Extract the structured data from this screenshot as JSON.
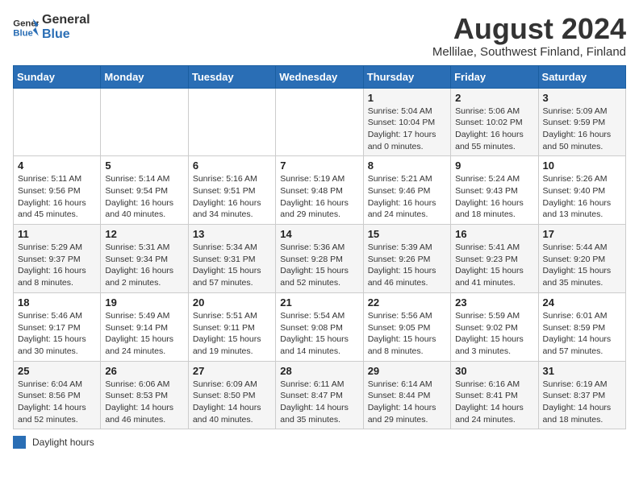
{
  "logo": {
    "general": "General",
    "blue": "Blue"
  },
  "title": "August 2024",
  "subtitle": "Mellilae, Southwest Finland, Finland",
  "days_of_week": [
    "Sunday",
    "Monday",
    "Tuesday",
    "Wednesday",
    "Thursday",
    "Friday",
    "Saturday"
  ],
  "weeks": [
    [
      {
        "day": "",
        "sunrise": "",
        "sunset": "",
        "daylight": ""
      },
      {
        "day": "",
        "sunrise": "",
        "sunset": "",
        "daylight": ""
      },
      {
        "day": "",
        "sunrise": "",
        "sunset": "",
        "daylight": ""
      },
      {
        "day": "",
        "sunrise": "",
        "sunset": "",
        "daylight": ""
      },
      {
        "day": "1",
        "sunrise": "Sunrise: 5:04 AM",
        "sunset": "Sunset: 10:04 PM",
        "daylight": "Daylight: 17 hours and 0 minutes."
      },
      {
        "day": "2",
        "sunrise": "Sunrise: 5:06 AM",
        "sunset": "Sunset: 10:02 PM",
        "daylight": "Daylight: 16 hours and 55 minutes."
      },
      {
        "day": "3",
        "sunrise": "Sunrise: 5:09 AM",
        "sunset": "Sunset: 9:59 PM",
        "daylight": "Daylight: 16 hours and 50 minutes."
      }
    ],
    [
      {
        "day": "4",
        "sunrise": "Sunrise: 5:11 AM",
        "sunset": "Sunset: 9:56 PM",
        "daylight": "Daylight: 16 hours and 45 minutes."
      },
      {
        "day": "5",
        "sunrise": "Sunrise: 5:14 AM",
        "sunset": "Sunset: 9:54 PM",
        "daylight": "Daylight: 16 hours and 40 minutes."
      },
      {
        "day": "6",
        "sunrise": "Sunrise: 5:16 AM",
        "sunset": "Sunset: 9:51 PM",
        "daylight": "Daylight: 16 hours and 34 minutes."
      },
      {
        "day": "7",
        "sunrise": "Sunrise: 5:19 AM",
        "sunset": "Sunset: 9:48 PM",
        "daylight": "Daylight: 16 hours and 29 minutes."
      },
      {
        "day": "8",
        "sunrise": "Sunrise: 5:21 AM",
        "sunset": "Sunset: 9:46 PM",
        "daylight": "Daylight: 16 hours and 24 minutes."
      },
      {
        "day": "9",
        "sunrise": "Sunrise: 5:24 AM",
        "sunset": "Sunset: 9:43 PM",
        "daylight": "Daylight: 16 hours and 18 minutes."
      },
      {
        "day": "10",
        "sunrise": "Sunrise: 5:26 AM",
        "sunset": "Sunset: 9:40 PM",
        "daylight": "Daylight: 16 hours and 13 minutes."
      }
    ],
    [
      {
        "day": "11",
        "sunrise": "Sunrise: 5:29 AM",
        "sunset": "Sunset: 9:37 PM",
        "daylight": "Daylight: 16 hours and 8 minutes."
      },
      {
        "day": "12",
        "sunrise": "Sunrise: 5:31 AM",
        "sunset": "Sunset: 9:34 PM",
        "daylight": "Daylight: 16 hours and 2 minutes."
      },
      {
        "day": "13",
        "sunrise": "Sunrise: 5:34 AM",
        "sunset": "Sunset: 9:31 PM",
        "daylight": "Daylight: 15 hours and 57 minutes."
      },
      {
        "day": "14",
        "sunrise": "Sunrise: 5:36 AM",
        "sunset": "Sunset: 9:28 PM",
        "daylight": "Daylight: 15 hours and 52 minutes."
      },
      {
        "day": "15",
        "sunrise": "Sunrise: 5:39 AM",
        "sunset": "Sunset: 9:26 PM",
        "daylight": "Daylight: 15 hours and 46 minutes."
      },
      {
        "day": "16",
        "sunrise": "Sunrise: 5:41 AM",
        "sunset": "Sunset: 9:23 PM",
        "daylight": "Daylight: 15 hours and 41 minutes."
      },
      {
        "day": "17",
        "sunrise": "Sunrise: 5:44 AM",
        "sunset": "Sunset: 9:20 PM",
        "daylight": "Daylight: 15 hours and 35 minutes."
      }
    ],
    [
      {
        "day": "18",
        "sunrise": "Sunrise: 5:46 AM",
        "sunset": "Sunset: 9:17 PM",
        "daylight": "Daylight: 15 hours and 30 minutes."
      },
      {
        "day": "19",
        "sunrise": "Sunrise: 5:49 AM",
        "sunset": "Sunset: 9:14 PM",
        "daylight": "Daylight: 15 hours and 24 minutes."
      },
      {
        "day": "20",
        "sunrise": "Sunrise: 5:51 AM",
        "sunset": "Sunset: 9:11 PM",
        "daylight": "Daylight: 15 hours and 19 minutes."
      },
      {
        "day": "21",
        "sunrise": "Sunrise: 5:54 AM",
        "sunset": "Sunset: 9:08 PM",
        "daylight": "Daylight: 15 hours and 14 minutes."
      },
      {
        "day": "22",
        "sunrise": "Sunrise: 5:56 AM",
        "sunset": "Sunset: 9:05 PM",
        "daylight": "Daylight: 15 hours and 8 minutes."
      },
      {
        "day": "23",
        "sunrise": "Sunrise: 5:59 AM",
        "sunset": "Sunset: 9:02 PM",
        "daylight": "Daylight: 15 hours and 3 minutes."
      },
      {
        "day": "24",
        "sunrise": "Sunrise: 6:01 AM",
        "sunset": "Sunset: 8:59 PM",
        "daylight": "Daylight: 14 hours and 57 minutes."
      }
    ],
    [
      {
        "day": "25",
        "sunrise": "Sunrise: 6:04 AM",
        "sunset": "Sunset: 8:56 PM",
        "daylight": "Daylight: 14 hours and 52 minutes."
      },
      {
        "day": "26",
        "sunrise": "Sunrise: 6:06 AM",
        "sunset": "Sunset: 8:53 PM",
        "daylight": "Daylight: 14 hours and 46 minutes."
      },
      {
        "day": "27",
        "sunrise": "Sunrise: 6:09 AM",
        "sunset": "Sunset: 8:50 PM",
        "daylight": "Daylight: 14 hours and 40 minutes."
      },
      {
        "day": "28",
        "sunrise": "Sunrise: 6:11 AM",
        "sunset": "Sunset: 8:47 PM",
        "daylight": "Daylight: 14 hours and 35 minutes."
      },
      {
        "day": "29",
        "sunrise": "Sunrise: 6:14 AM",
        "sunset": "Sunset: 8:44 PM",
        "daylight": "Daylight: 14 hours and 29 minutes."
      },
      {
        "day": "30",
        "sunrise": "Sunrise: 6:16 AM",
        "sunset": "Sunset: 8:41 PM",
        "daylight": "Daylight: 14 hours and 24 minutes."
      },
      {
        "day": "31",
        "sunrise": "Sunrise: 6:19 AM",
        "sunset": "Sunset: 8:37 PM",
        "daylight": "Daylight: 14 hours and 18 minutes."
      }
    ]
  ],
  "legend": {
    "box_label": "Daylight hours"
  }
}
